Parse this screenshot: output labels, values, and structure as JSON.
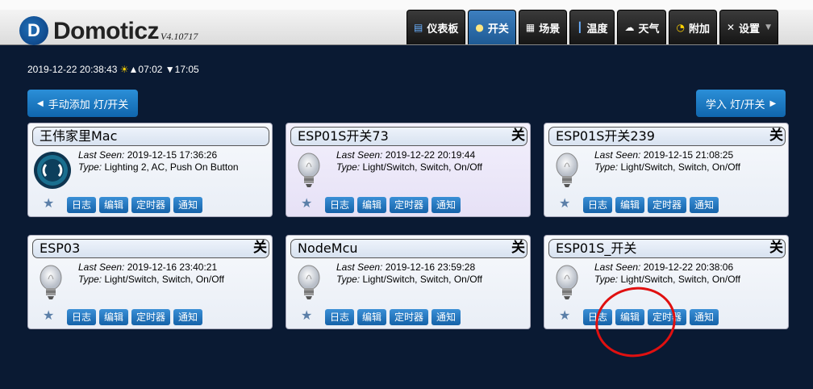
{
  "app": {
    "name": "Domoticz",
    "version": "V4.10717"
  },
  "nav": [
    {
      "icon": "dashboard-icon",
      "label": "仪表板",
      "active": false
    },
    {
      "icon": "bulb-icon",
      "label": "开关",
      "active": true
    },
    {
      "icon": "scene-icon",
      "label": "场景",
      "active": false
    },
    {
      "icon": "thermometer-icon",
      "label": "温度",
      "active": false
    },
    {
      "icon": "weather-icon",
      "label": "天气",
      "active": false
    },
    {
      "icon": "utility-icon",
      "label": "附加",
      "active": false
    },
    {
      "icon": "settings-icon",
      "label": "设置",
      "active": false
    }
  ],
  "status_bar": {
    "datetime": "2019-12-22 20:38:43",
    "sunrise": "▲07:02",
    "sunset": "▼17:05"
  },
  "buttons": {
    "add_manual": "手动添加 灯/开关",
    "learn": "学入 灯/开关"
  },
  "labels": {
    "last_seen": "Last Seen:",
    "type": "Type:"
  },
  "actions": [
    "日志",
    "编辑",
    "定时器",
    "通知"
  ],
  "devices": [
    {
      "name": "王伟家里Mac",
      "status": "",
      "last_seen": "2019-12-15 17:36:26",
      "type": "Lighting 2, AC, Push On Button",
      "icon": "push-button-icon"
    },
    {
      "name": "ESP01S开关73",
      "status": "关",
      "last_seen": "2019-12-22 20:19:44",
      "type": "Light/Switch, Switch, On/Off",
      "icon": "light-bulb-icon"
    },
    {
      "name": "ESP01S开关239",
      "status": "关",
      "last_seen": "2019-12-15 21:08:25",
      "type": "Light/Switch, Switch, On/Off",
      "icon": "light-bulb-icon"
    },
    {
      "name": "ESP03",
      "status": "关",
      "last_seen": "2019-12-16 23:40:21",
      "type": "Light/Switch, Switch, On/Off",
      "icon": "light-bulb-icon"
    },
    {
      "name": "NodeMcu",
      "status": "关",
      "last_seen": "2019-12-16 23:59:28",
      "type": "Light/Switch, Switch, On/Off",
      "icon": "light-bulb-icon"
    },
    {
      "name": "ESP01S_开关",
      "status": "关",
      "last_seen": "2019-12-22 20:38:06",
      "type": "Light/Switch, Switch, On/Off",
      "icon": "light-bulb-icon"
    }
  ]
}
